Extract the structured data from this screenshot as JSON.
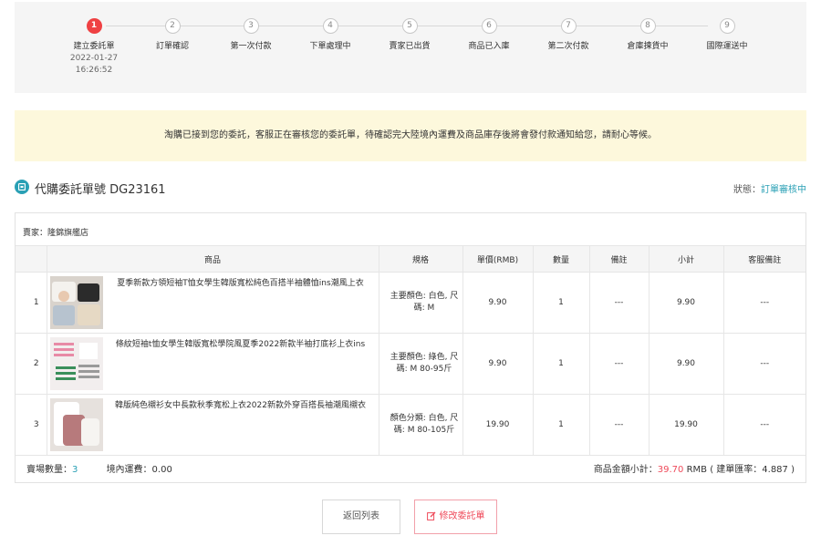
{
  "steps": [
    {
      "num": "1",
      "label": "建立委託單",
      "date": "2022-01-27",
      "time": "16:26:52",
      "active": true
    },
    {
      "num": "2",
      "label": "訂單確認"
    },
    {
      "num": "3",
      "label": "第一次付款"
    },
    {
      "num": "4",
      "label": "下單處理中"
    },
    {
      "num": "5",
      "label": "賣家已出貨"
    },
    {
      "num": "6",
      "label": "商品已入庫"
    },
    {
      "num": "7",
      "label": "第二次付款"
    },
    {
      "num": "8",
      "label": "倉庫揀貨中"
    },
    {
      "num": "9",
      "label": "國際運送中"
    }
  ],
  "notice": "淘購已接到您的委託，客服正在審核您的委託單，待確認完大陸境內運費及商品庫存後將會發付款通知給您，請耐心等候。",
  "order": {
    "title": "代購委託單號 DG23161",
    "status_label": "狀態：",
    "status_value": "訂單審核中"
  },
  "seller": "賣家：隆錦旗艦店",
  "table": {
    "headers": {
      "product": "商品",
      "spec": "規格",
      "price": "單價(RMB)",
      "qty": "數量",
      "note": "備註",
      "subtotal": "小計",
      "cs_note": "客服備註"
    },
    "rows": [
      {
        "idx": "1",
        "name": "夏季新款方領短袖T恤女學生韓版寬松純色百搭半袖體恤ins潮風上衣",
        "spec_line1": "主要顏色: 白色, 尺",
        "spec_line2": "碼: M",
        "price": "9.90",
        "qty": "1",
        "note": "---",
        "subtotal": "9.90",
        "cs_note": "---"
      },
      {
        "idx": "2",
        "name": "條紋短袖t恤女學生韓版寬松學院風夏季2022新款半袖打底衫上衣ins",
        "spec_line1": "主要顏色: 綠色, 尺",
        "spec_line2": "碼: M 80-95斤",
        "price": "9.90",
        "qty": "1",
        "note": "---",
        "subtotal": "9.90",
        "cs_note": "---"
      },
      {
        "idx": "3",
        "name": "韓版純色襯衫女中長款秋季寬松上衣2022新款外穿百搭長袖潮風襯衣",
        "spec_line1": "顏色分類: 白色, 尺",
        "spec_line2": "碼: M 80-105斤",
        "price": "19.90",
        "qty": "1",
        "note": "---",
        "subtotal": "19.90",
        "cs_note": "---"
      }
    ]
  },
  "summary": {
    "count_label": "賣場數量：",
    "count_value": "3",
    "shipping": "境內運費：0.00",
    "amount_label": "商品金額小計：",
    "amount_value": "39.70",
    "amount_suffix": " RMB ( 建單匯率：4.887 )"
  },
  "buttons": {
    "back": "返回列表",
    "edit": "修改委託單"
  },
  "colors": {
    "accent": "#2aa0b5",
    "active_step": "#ef4143",
    "price_red": "#ef4a5a",
    "notice_bg": "#fdf8dc"
  }
}
